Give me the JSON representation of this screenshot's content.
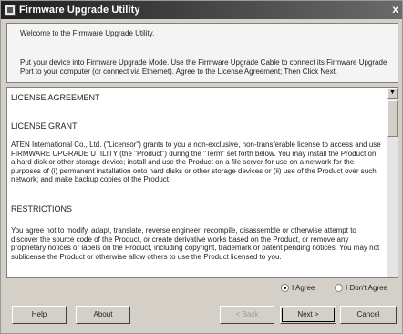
{
  "window": {
    "title": "Firmware Upgrade Utility",
    "close_glyph": "x"
  },
  "intro": {
    "welcome": "Welcome to the Firmware Upgrade Utility.",
    "instructions": "Put your device into Firmware Upgrade Mode. Use the Firmware Upgrade Cable to connect its Firmware Upgrade Port to your computer (or connect via Ethernet). Agree to the License Agreement; Then Click Next."
  },
  "license": {
    "heading": "LICENSE AGREEMENT",
    "grant_heading": "LICENSE GRANT",
    "grant_text": "ATEN International Co., Ltd. (\"Licensor\") grants to you a non-exclusive, non-transferable license to access and use FIRMWARE UPGRADE UTILITY (the \"Product\") during the \"Term\" set forth below. You may install the Product on a hard disk or other storage device; install and use the Product on a file server for use on a network for the purposes of (i) permanent installation onto hard disks or other storage devices or (ii) use of the Product over such network; and make backup copies of the Product.",
    "restrictions_heading": "RESTRICTIONS",
    "restrictions_text": "You agree not to modify, adapt, translate, reverse engineer, recompile, disassemble or otherwise attempt to discover the source code of the Product, or create derivative works based on the Product, or remove any proprietary notices or labels on the Product, including copyright, trademark or patent pending notices. You may not sublicense the Product or otherwise allow others to use the Product licensed to you."
  },
  "agreement": {
    "agree_label": "I Agree",
    "disagree_label": "I Don't Agree",
    "selected": "agree"
  },
  "buttons": {
    "help": "Help",
    "about": "About",
    "back": "< Back",
    "next": "Next >",
    "cancel": "Cancel"
  }
}
